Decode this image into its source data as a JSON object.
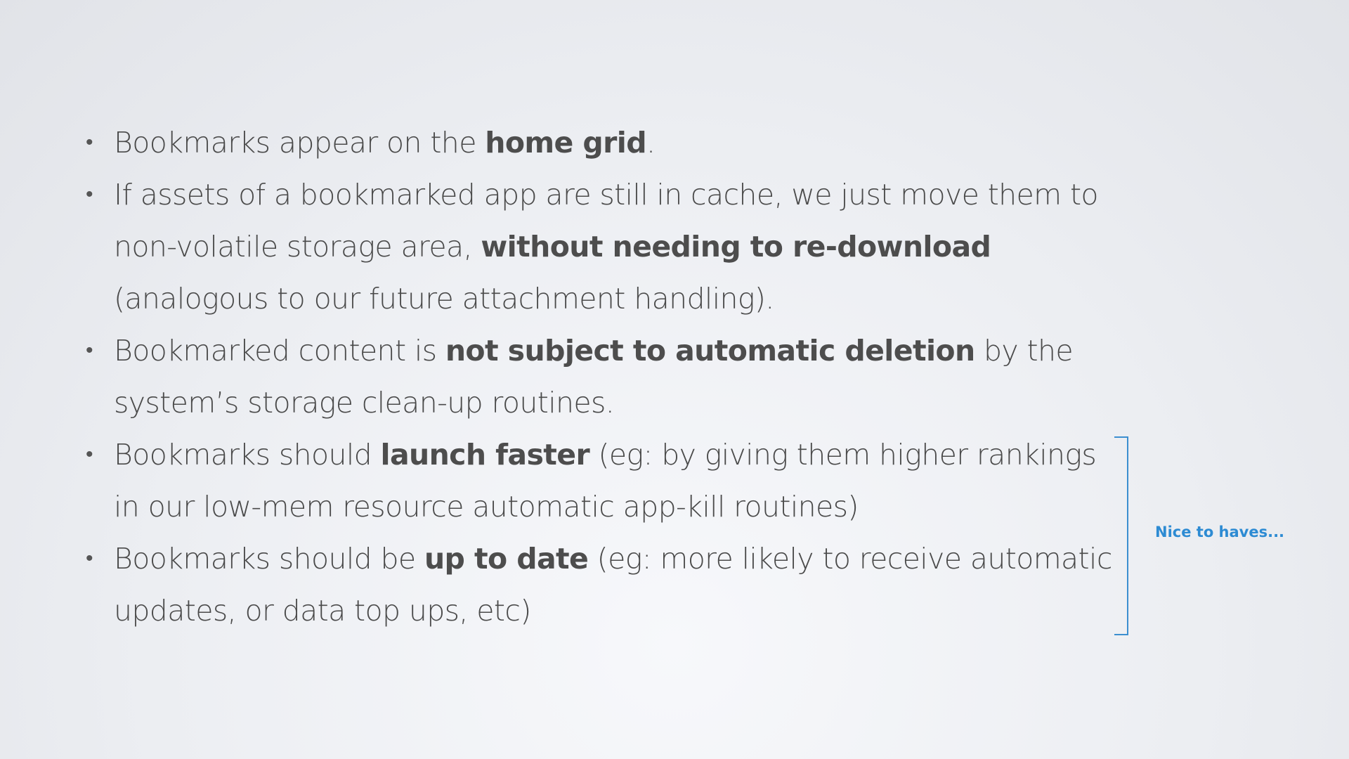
{
  "bullets": [
    {
      "parts": [
        {
          "text": "Bookmarks appear on the "
        },
        {
          "text": "home grid",
          "bold": true
        },
        {
          "text": "."
        }
      ]
    },
    {
      "parts": [
        {
          "text": "If assets of a bookmarked app are still in cache, we just move them to non-volatile storage area, "
        },
        {
          "text": "without needing to re-download",
          "bold": true
        },
        {
          "text": " (analogous to our future attachment handling)."
        }
      ]
    },
    {
      "parts": [
        {
          "text": "Bookmarked content is "
        },
        {
          "text": "not subject to automatic deletion",
          "bold": true
        },
        {
          "text": " by the system’s storage clean-up routines."
        }
      ]
    },
    {
      "parts": [
        {
          "text": "Bookmarks should "
        },
        {
          "text": "launch faster",
          "bold": true
        },
        {
          "text": " (eg: by giving them higher rankings in our low-mem resource automatic app-kill routines)"
        }
      ]
    },
    {
      "parts": [
        {
          "text": "Bookmarks should be "
        },
        {
          "text": "up to date",
          "bold": true
        },
        {
          "text": " (eg: more likely to receive automatic updates, or data top ups, etc)"
        }
      ]
    }
  ],
  "annotation": {
    "label": "Nice to haves...",
    "color": "#2d8bd3"
  },
  "colors": {
    "text": "#4a4a4a",
    "accent": "#3c8fd0"
  }
}
